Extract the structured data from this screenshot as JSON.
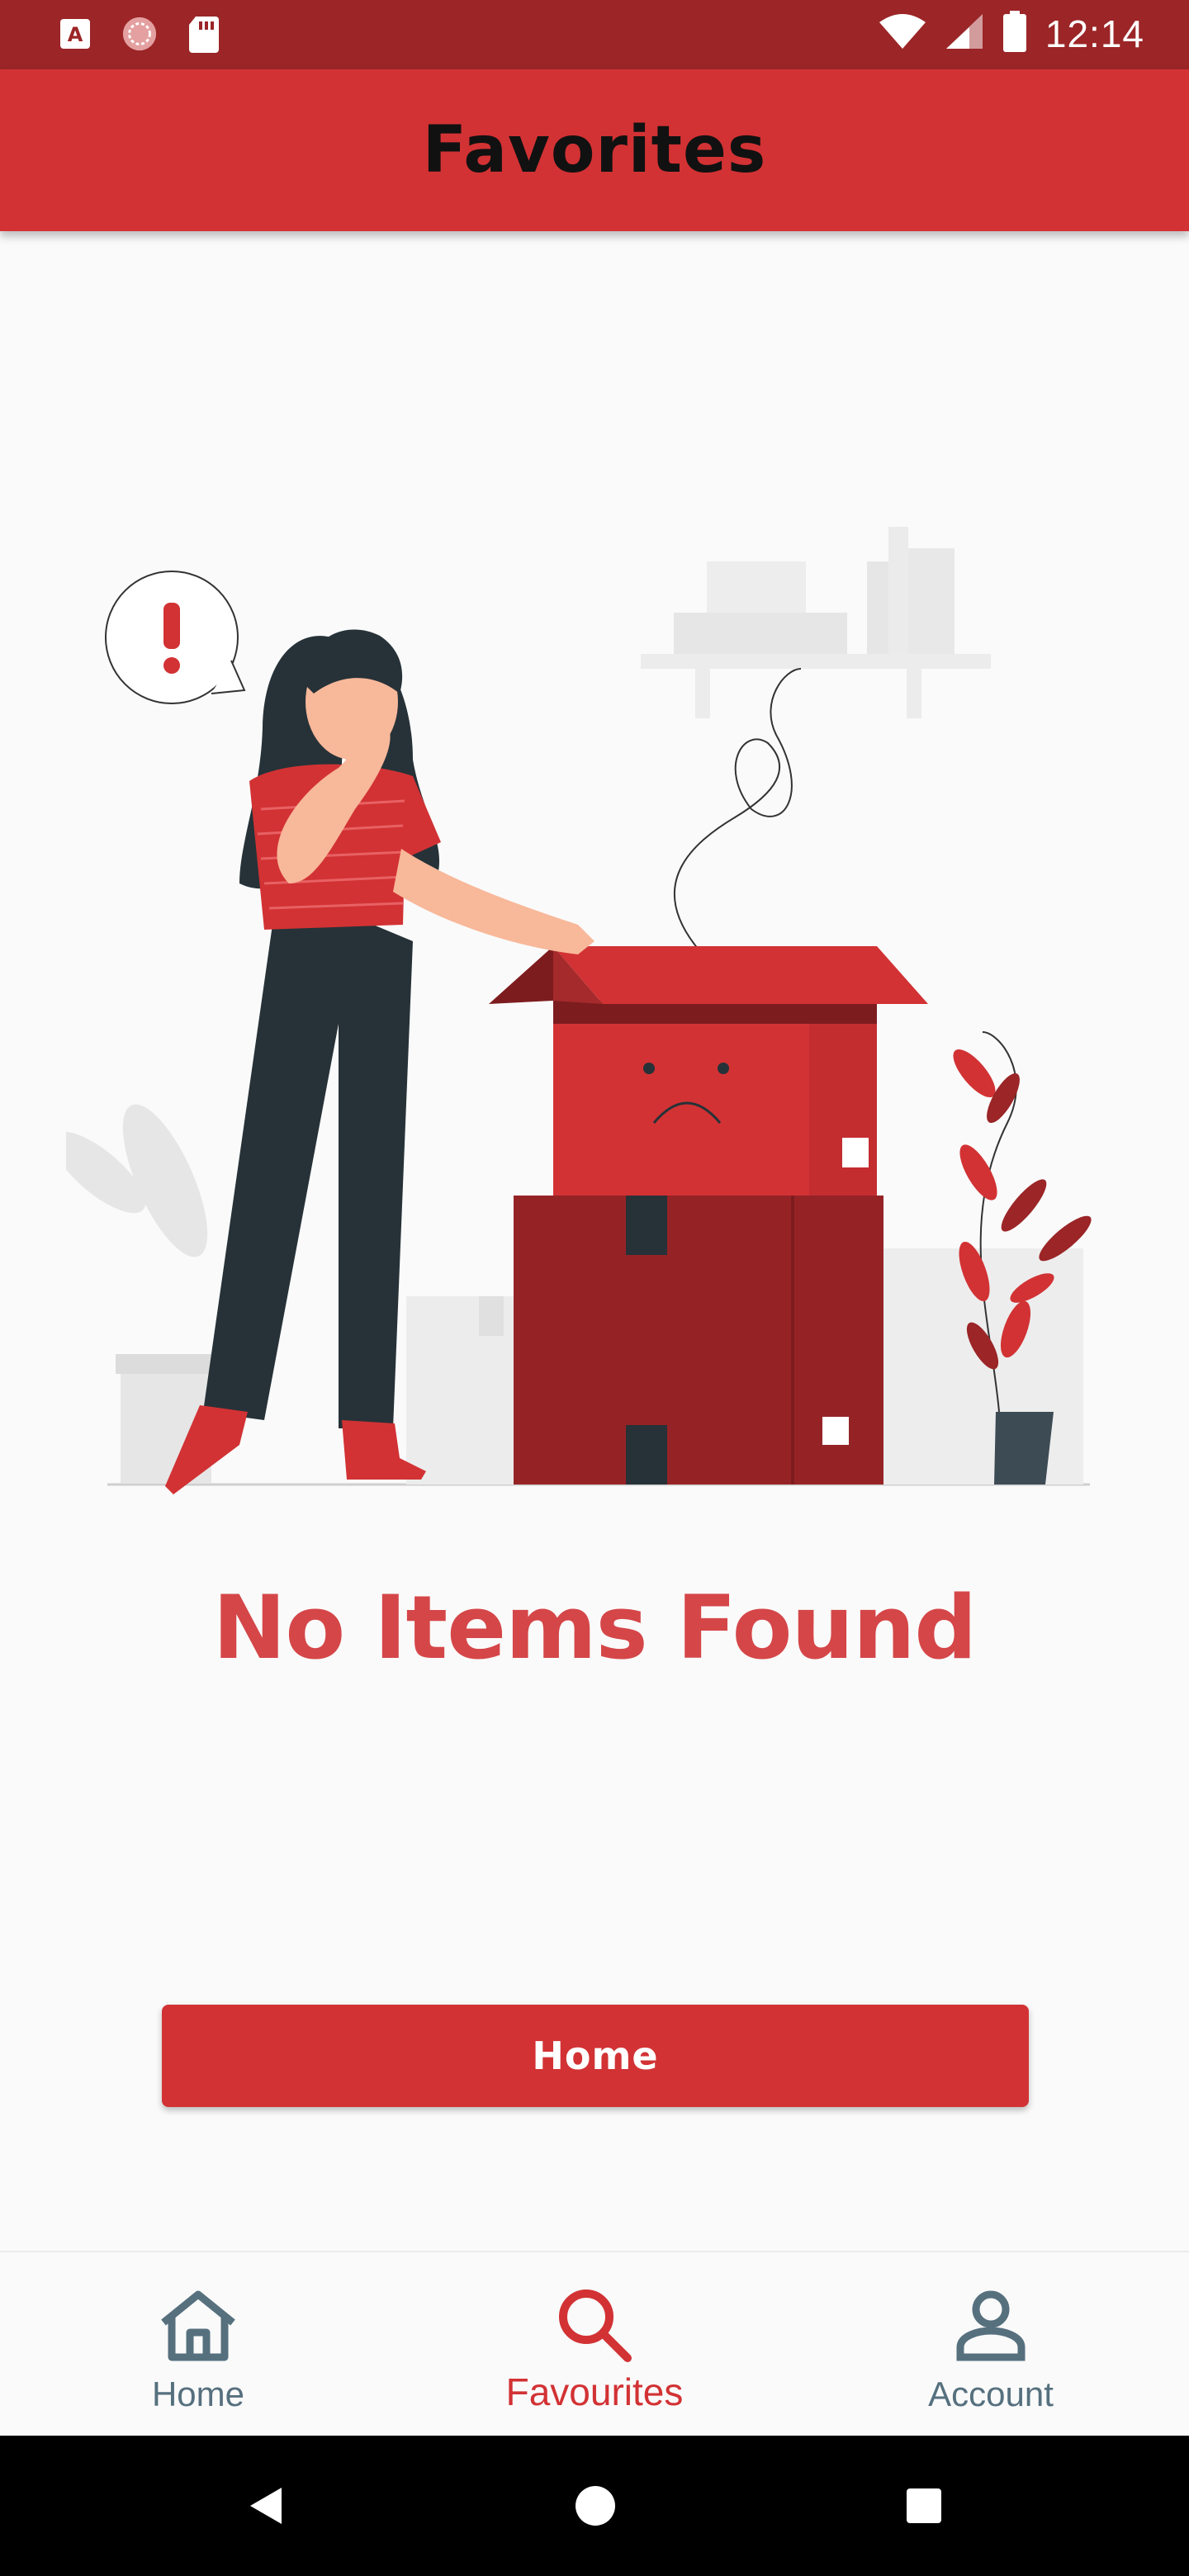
{
  "status_bar": {
    "time": "12:14",
    "left_icons": [
      "a-badge-icon",
      "sync-icon",
      "sd-card-icon"
    ],
    "right_icons": [
      "wifi-icon",
      "signal-icon",
      "battery-icon"
    ]
  },
  "app_bar": {
    "title": "Favorites"
  },
  "empty_state": {
    "message": "No Items Found"
  },
  "home_button": {
    "label": "Home"
  },
  "bottom_nav": {
    "items": [
      {
        "label": "Home",
        "icon": "home-icon",
        "active": false
      },
      {
        "label": "Favourites",
        "icon": "search-icon",
        "active": true
      },
      {
        "label": "Account",
        "icon": "account-icon",
        "active": false
      }
    ]
  },
  "system_nav": {
    "buttons": [
      "back-icon",
      "home-circle-icon",
      "recents-icon"
    ]
  },
  "colors": {
    "primary": "#d23234",
    "status_bar": "#9b2527",
    "empty_text": "#d54648",
    "nav_inactive": "#56707e"
  }
}
